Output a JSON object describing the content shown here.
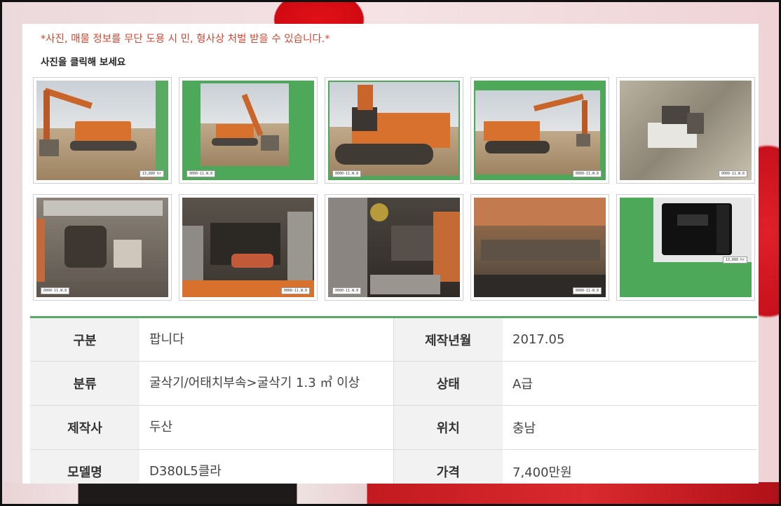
{
  "notice": {
    "warning": "*사진, 매물 정보를 무단 도용 시 민, 형사상 처벌 받을 수 있습니다.*",
    "click_hint": "사진을 클릭해 보세요"
  },
  "gallery": [
    {
      "kind": "excavator-side",
      "tag": "13,880 hr"
    },
    {
      "kind": "excavator-front",
      "tag": "0000-11.W.8"
    },
    {
      "kind": "excavator-rear",
      "tag": "0000-11.W.8"
    },
    {
      "kind": "excavator-side2",
      "tag": "0000-11.W.8"
    },
    {
      "kind": "rock-dirt",
      "tag": "0000-11.W.8"
    },
    {
      "kind": "engine-bay",
      "tag": "0000-11.W.8"
    },
    {
      "kind": "battery-box",
      "tag": "0000-11.W.8"
    },
    {
      "kind": "hydraulic-lines",
      "tag": "0000-11.W.8"
    },
    {
      "kind": "undercarriage",
      "tag": "0000-11.W.8"
    },
    {
      "kind": "hour-meter",
      "tag": "13,880 hr"
    }
  ],
  "spec": {
    "rows": [
      {
        "label1": "구분",
        "value1": "팝니다",
        "label2": "제작년월",
        "value2": "2017.05"
      },
      {
        "label1": "분류",
        "value1": "굴삭기/어태치부속>굴삭기 1.3 ㎥ 이상",
        "label2": "상태",
        "value2": "A급"
      },
      {
        "label1": "제작사",
        "value1": "두산",
        "label2": "위치",
        "value2": "충남"
      },
      {
        "label1": "모델명",
        "value1": "D380L5클라",
        "label2": "가격",
        "value2": "7,400만원"
      }
    ]
  },
  "colors": {
    "warning": "#d8442f",
    "accent_green": "#5aa868",
    "photo_bg_green": "#4da85a"
  }
}
